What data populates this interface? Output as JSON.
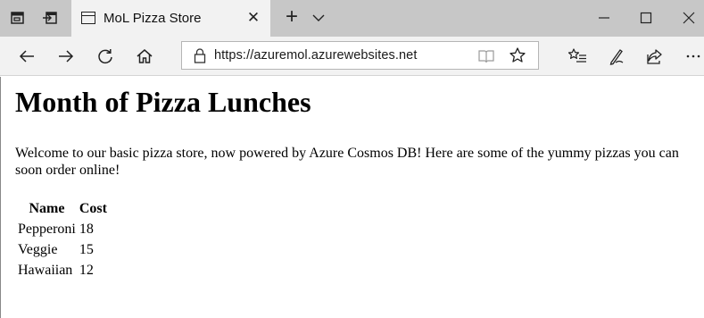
{
  "tab": {
    "title": "MoL Pizza Store"
  },
  "address_bar": {
    "url": "https://azuremol.azurewebsites.net"
  },
  "page": {
    "heading": "Month of Pizza Lunches",
    "intro": "Welcome to our basic pizza store, now powered by Azure Cosmos DB! Here are some of the yummy pizzas you can soon order online!",
    "table": {
      "columns": [
        "Name",
        "Cost"
      ],
      "rows": [
        {
          "name": "Pepperoni",
          "cost": "18"
        },
        {
          "name": "Veggie",
          "cost": "15"
        },
        {
          "name": "Hawaiian",
          "cost": "12"
        }
      ]
    }
  },
  "colors": {
    "titlebar": "#c7c7c7",
    "active_tab": "#f2f2f2",
    "navbar": "#f2f2f2",
    "page_background": "#ffffff"
  },
  "icons": {
    "titlebar_left": [
      "set-aside-tabs-icon",
      "restore-tabs-icon"
    ],
    "tab": [
      "page-icon",
      "close-icon"
    ],
    "titlebar_right": [
      "new-tab-icon",
      "tab-list-chevron-icon",
      "minimize-icon",
      "maximize-icon",
      "close-window-icon"
    ],
    "nav_left": [
      "back-arrow-icon",
      "forward-arrow-icon",
      "refresh-icon",
      "home-icon"
    ],
    "address": [
      "lock-icon",
      "reading-view-icon",
      "favorite-star-icon"
    ],
    "nav_right": [
      "favorites-list-icon",
      "pen-icon",
      "share-icon",
      "more-icon"
    ]
  }
}
